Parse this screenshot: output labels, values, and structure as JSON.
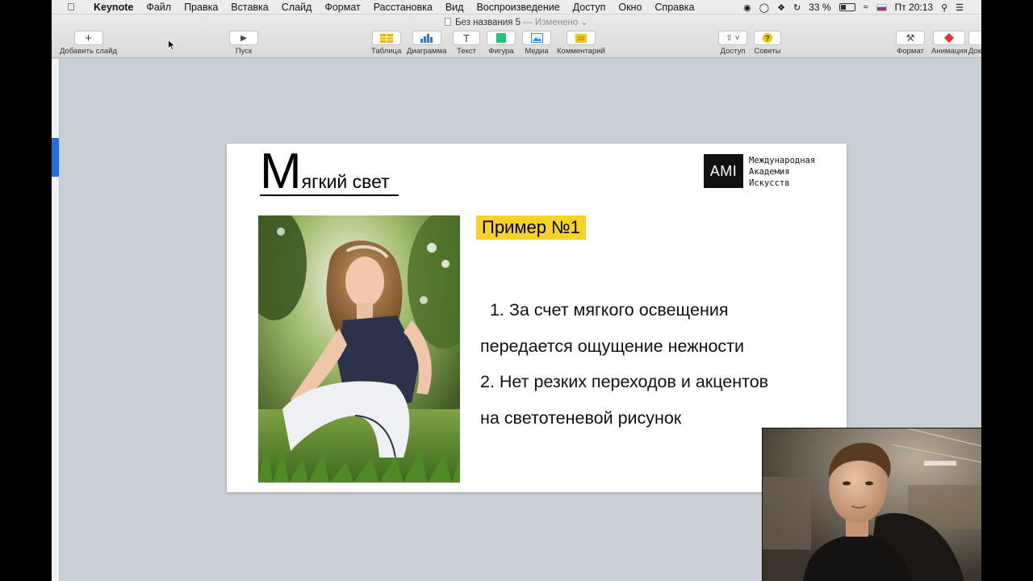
{
  "menubar": {
    "app_name": "Keynote",
    "items": [
      "Файл",
      "Правка",
      "Вставка",
      "Слайд",
      "Формат",
      "Расстановка",
      "Вид",
      "Воспроизведение",
      "Доступ",
      "Окно",
      "Справка"
    ],
    "battery_percent": "33 %",
    "clock": "Пт 20:13"
  },
  "document": {
    "title": "Без названия 5",
    "status": "— Изменено ⌄"
  },
  "toolbar": {
    "add_slide": "Добавить слайд",
    "play": "Пуск",
    "table": "Таблица",
    "chart": "Диаграмма",
    "text": "Текст",
    "shape": "Фигура",
    "media": "Медиа",
    "comment": "Комментарий",
    "share": "Доступ",
    "tips": "Советы",
    "format": "Формат",
    "animate": "Анимация",
    "document": "Док"
  },
  "slide": {
    "title_first_letter": "М",
    "title_rest": "ягкий свет",
    "logo_abbrev": "AMI",
    "logo_lines": [
      "Международная",
      "Академия",
      "Искусств"
    ],
    "badge": "Пример №1",
    "bullet_lines": [
      "  1. За счет мягкого освещения",
      "передается ощущение нежности",
      "2. Нет резких переходов и акцентов",
      "на светотеневой рисунок"
    ]
  },
  "colors": {
    "badge_yellow": "#f5d327",
    "selection_blue": "#1f6fe0",
    "canvas_gray": "#c9cfd6"
  }
}
